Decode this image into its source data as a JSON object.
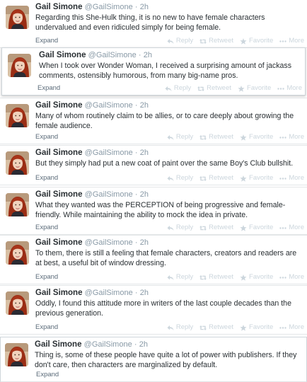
{
  "author": {
    "name": "Gail Simone",
    "handle": "@GailSimone",
    "separator": "·",
    "time": "2h"
  },
  "labels": {
    "expand": "Expand",
    "reply": "Reply",
    "retweet": "Retweet",
    "favorite": "Favorite",
    "more": "More"
  },
  "tweets": [
    {
      "text": "Regarding this She-Hulk thing, it is no new to have female characters undervalued and even ridiculed simply for being female."
    },
    {
      "text": "When I took over Wonder Woman, I received a surprising amount of jackass comments, ostensibly humorous, from many big-name pros."
    },
    {
      "text": "Many of whom routinely claim to be allies, or to care deeply about growing the female audience."
    },
    {
      "text": "But they simply had put a new coat of paint over the same Boy's Club bullshit."
    },
    {
      "text": "What they wanted was the PERCEPTION of being progressive and female-friendly. While maintaining the ability to mock the idea in private."
    },
    {
      "text": "To them, there is still a feeling that female characters, creators and readers are at best, a useful bit of window dressing."
    },
    {
      "text": "Oddly, I found this attitude more in writers of the last couple decades than the previous generation."
    },
    {
      "text": "Thing is, some of these people have quite a lot of power with publishers. If they don't care, then characters are marginalized by default."
    }
  ],
  "colors": {
    "name": "#292f33",
    "meta": "#8899a6",
    "action": "#ccd6dd",
    "expand": "#5b6b79"
  }
}
